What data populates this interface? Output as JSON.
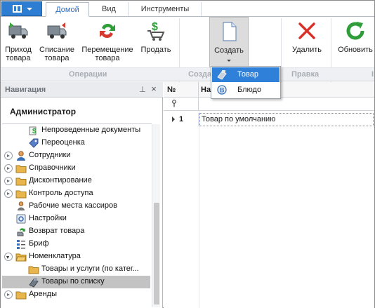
{
  "ribbon": {
    "tabs": [
      {
        "label": "Домой",
        "active": true
      },
      {
        "label": "Вид",
        "active": false
      },
      {
        "label": "Инструменты",
        "active": false
      }
    ],
    "buttons": {
      "receipt": {
        "line1": "Приход",
        "line2": "товара",
        "icon": "truck-receive-icon"
      },
      "writeoff": {
        "line1": "Списание",
        "line2": "товара",
        "icon": "truck-writeoff-icon"
      },
      "move": {
        "line1": "Перемещение",
        "line2": "товара",
        "icon": "move-arrows-icon"
      },
      "sale": {
        "line1": "Продать",
        "icon": "cart-dollar-icon"
      },
      "create": {
        "line1": "Создать",
        "icon": "new-document-icon"
      },
      "delete": {
        "line1": "Удалить",
        "icon": "delete-x-icon"
      },
      "refresh": {
        "line1": "Обновить",
        "icon": "refresh-icon"
      }
    },
    "groups": {
      "operations": "Операции",
      "create": "Созда",
      "edit": "Правка",
      "trailing": "I"
    }
  },
  "create_menu": {
    "items": [
      {
        "label": "Товар",
        "icon": "product-tag-icon",
        "highlighted": true
      },
      {
        "label": "Блюдо",
        "icon": "dish-icon",
        "highlighted": false
      }
    ]
  },
  "navigation": {
    "title": "Навигация",
    "pin_glyph": "⊥",
    "close_glyph": "×",
    "user": "Администратор",
    "items": [
      {
        "label": "Непроведенные документы",
        "icon": "document-dollar-icon",
        "expander": "none"
      },
      {
        "label": "Переоценка",
        "icon": "price-tag-icon",
        "expander": "none"
      },
      {
        "label": "Сотрудники",
        "icon": "user-icon",
        "expander": "collapsed"
      },
      {
        "label": "Справочники",
        "icon": "folder-icon",
        "expander": "collapsed"
      },
      {
        "label": "Дисконтирование",
        "icon": "folder-icon",
        "expander": "collapsed"
      },
      {
        "label": "Контроль доступа",
        "icon": "folder-icon",
        "expander": "collapsed"
      },
      {
        "label": "Рабочие места кассиров",
        "icon": "cashier-icon",
        "expander": "none"
      },
      {
        "label": "Настройки",
        "icon": "settings-icon",
        "expander": "none"
      },
      {
        "label": "Возврат товара",
        "icon": "return-icon",
        "expander": "none"
      },
      {
        "label": "Бриф",
        "icon": "brief-icon",
        "expander": "none"
      },
      {
        "label": "Номенклатура",
        "icon": "folder-open-icon",
        "expander": "expanded"
      },
      {
        "label": "Товары и услуги (по катег...",
        "icon": "folder-icon",
        "expander": "none"
      },
      {
        "label": "Товары по списку",
        "icon": "product-list-icon",
        "expander": "none",
        "selected": true
      },
      {
        "label": "Аренды",
        "icon": "folder-icon",
        "expander": "collapsed"
      }
    ]
  },
  "grid": {
    "columns": [
      "№",
      "На"
    ],
    "rows": [
      {
        "num": "1",
        "name": "Товар по умолчанию"
      }
    ]
  },
  "colors": {
    "accent": "#2d7dd2",
    "highlight": "#2f80d9",
    "selected_row": "#c3c3c3"
  }
}
